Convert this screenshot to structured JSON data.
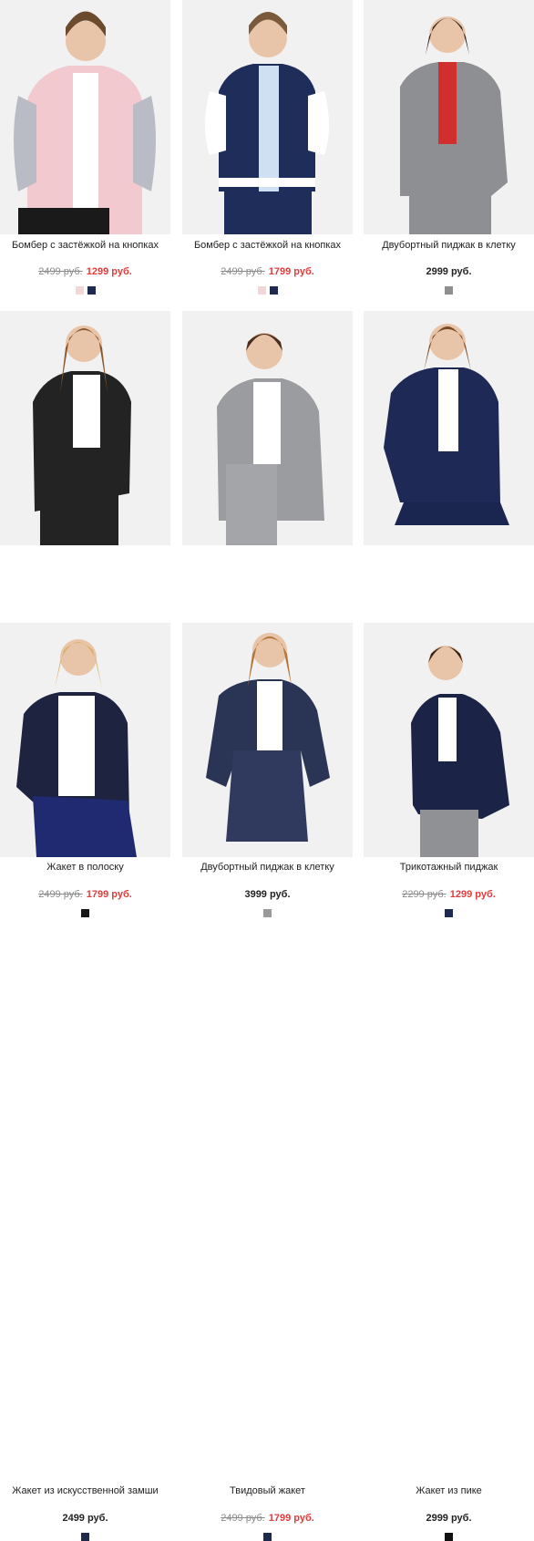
{
  "products": [
    {
      "name": "Бомбер с застёжкой на кнопках",
      "old_price": "2499 руб.",
      "price": "1299 руб.",
      "sale": true,
      "colors": [
        "#f3d6d8",
        "#1d2a4e"
      ]
    },
    {
      "name": "Бомбер с застёжкой на кнопках",
      "old_price": "2499 руб.",
      "price": "1799 руб.",
      "sale": true,
      "colors": [
        "#f3d6d8",
        "#1d2a4e"
      ]
    },
    {
      "name": "Двубортный пиджак в клетку",
      "old_price": "",
      "price": "2999 руб.",
      "sale": false,
      "colors": [
        "#8f8f8f"
      ]
    },
    {
      "name": "Жакет в полоску",
      "old_price": "2499 руб.",
      "price": "1799 руб.",
      "sale": true,
      "colors": [
        "#161616"
      ]
    },
    {
      "name": "Двубортный пиджак в клетку",
      "old_price": "",
      "price": "3999 руб.",
      "sale": false,
      "colors": [
        "#9a9a9a"
      ]
    },
    {
      "name": "Трикотажный пиджак",
      "old_price": "2299 руб.",
      "price": "1299 руб.",
      "sale": true,
      "colors": [
        "#1d2a4e"
      ]
    },
    {
      "name": "Жакет из искусственной замши",
      "old_price": "",
      "price": "2499 руб.",
      "sale": false,
      "colors": [
        "#1d2a4e"
      ]
    },
    {
      "name": "Твидовый жакет",
      "old_price": "2499 руб.",
      "price": "1799 руб.",
      "sale": true,
      "colors": [
        "#1d2a4e"
      ]
    },
    {
      "name": "Жакет из пике",
      "old_price": "",
      "price": "2999 руб.",
      "sale": false,
      "colors": [
        "#111111"
      ]
    }
  ],
  "colors": {
    "sale_price": "#e53b3b",
    "old_price": "#8a8a8a",
    "photo_bg": "#f1f1f1"
  }
}
